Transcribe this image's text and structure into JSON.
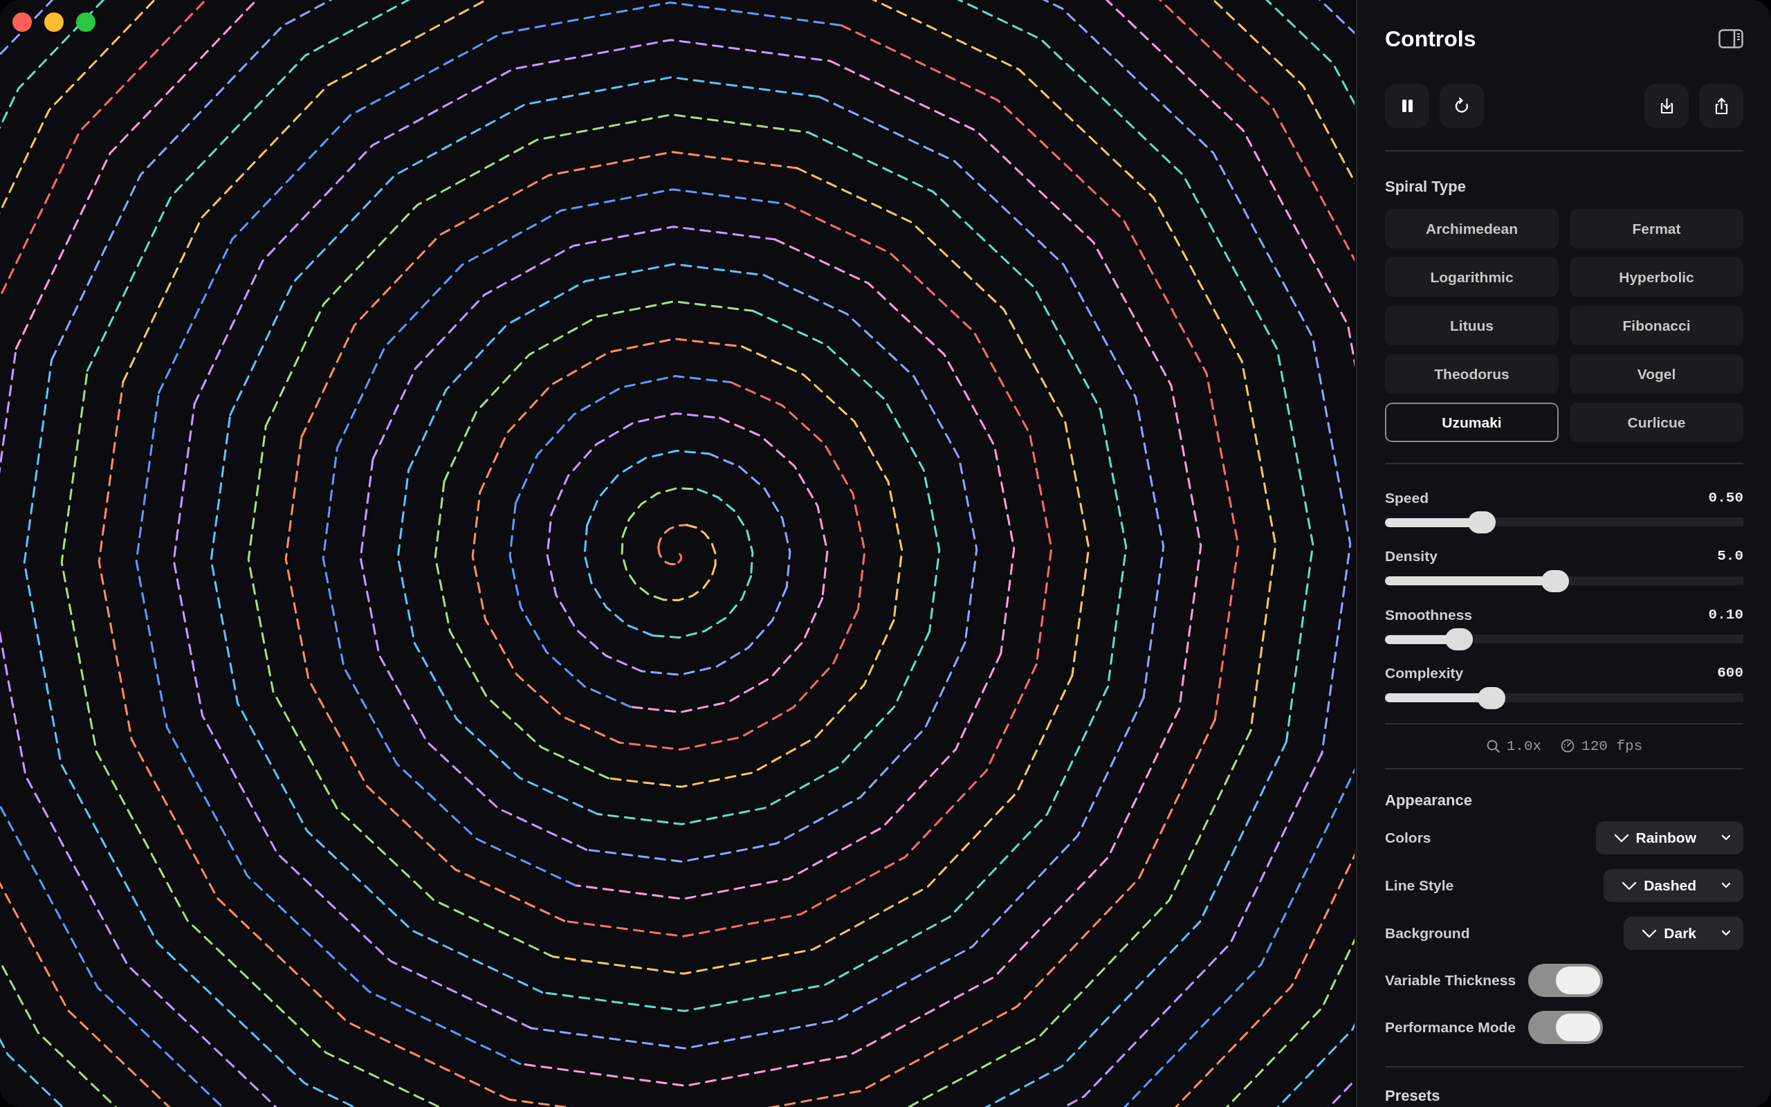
{
  "window": {
    "controls": [
      {
        "color": "#ff5f57"
      },
      {
        "color": "#febc2e"
      },
      {
        "color": "#28c840"
      }
    ]
  },
  "panel": {
    "title": "Controls"
  },
  "toolbar": {
    "left": [
      {
        "kind": "pause"
      },
      {
        "kind": "reset"
      }
    ],
    "right": [
      {
        "kind": "download"
      },
      {
        "kind": "share"
      }
    ]
  },
  "spiral_type": {
    "title": "Spiral Type",
    "options": [
      {
        "label": "Archimedean",
        "selected": false
      },
      {
        "label": "Fermat",
        "selected": false
      },
      {
        "label": "Logarithmic",
        "selected": false
      },
      {
        "label": "Hyperbolic",
        "selected": false
      },
      {
        "label": "Lituus",
        "selected": false
      },
      {
        "label": "Fibonacci",
        "selected": false
      },
      {
        "label": "Theodorus",
        "selected": false
      },
      {
        "label": "Vogel",
        "selected": false
      },
      {
        "label": "Uzumaki",
        "selected": true
      },
      {
        "label": "Curlicue",
        "selected": false
      }
    ]
  },
  "sliders": [
    {
      "label": "Speed",
      "reading": "0.50",
      "level": 0.27
    },
    {
      "label": "Density",
      "reading": "5.0",
      "level": 0.475
    },
    {
      "label": "Smoothness",
      "reading": "0.10",
      "level": 0.207
    },
    {
      "label": "Complexity",
      "reading": "600",
      "level": 0.298
    }
  ],
  "status": [
    {
      "kind": "zoom",
      "text": "1.0x"
    },
    {
      "kind": "fps",
      "text": "120 fps"
    }
  ],
  "appearance": {
    "title": "Appearance",
    "selects": [
      {
        "label": "Colors",
        "value": "Rainbow"
      },
      {
        "label": "Line Style",
        "value": "Dashed"
      },
      {
        "label": "Background",
        "value": "Dark"
      }
    ],
    "toggles": [
      {
        "label": "Variable Thickness",
        "on": true
      },
      {
        "label": "Performance Mode",
        "on": true
      }
    ]
  },
  "presets": {
    "title": "Presets"
  }
}
